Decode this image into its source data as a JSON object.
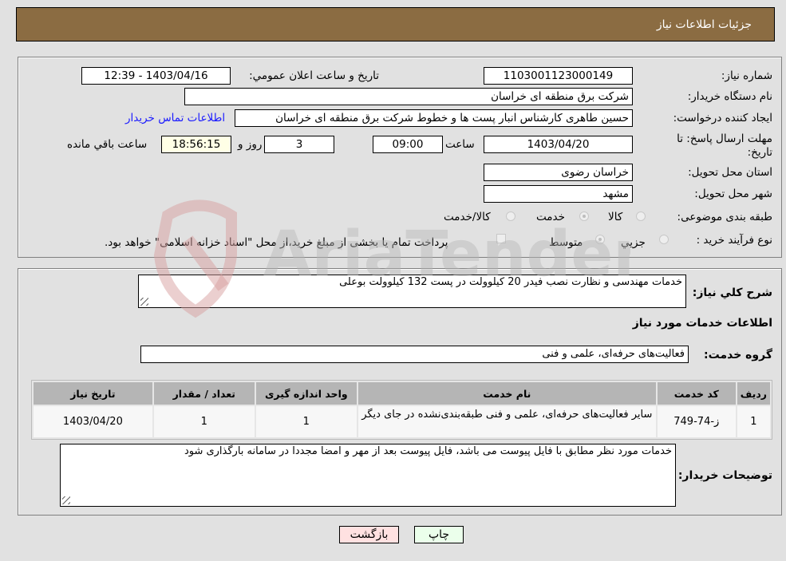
{
  "header": {
    "title": "جزئیات اطلاعات نیاز"
  },
  "form": {
    "need_number": {
      "label": "شماره نیاز:",
      "value": "1103001123000149"
    },
    "announce_datetime": {
      "label": "تاریخ و ساعت اعلان عمومي:",
      "value": "1403/04/16 - 12:39"
    },
    "buyer_org": {
      "label": "نام دستگاه خريدار:",
      "value": "شرکت برق منطقه ای خراسان"
    },
    "requester": {
      "label": "ایجاد کننده درخواست:",
      "value": "حسین طاهری کارشناس انبار پست ها و خطوط شرکت برق منطقه ای خراسان"
    },
    "contact_link": "اطلاعات تماس خريدار",
    "deadline": {
      "label": "مهلت ارسال پاسخ: تا تاریخ:",
      "date": "1403/04/20",
      "time_label": "ساعت",
      "time": "09:00",
      "days": "3",
      "days_label": "روز و",
      "remaining": "18:56:15",
      "remaining_label": "ساعت باقي مانده"
    },
    "province": {
      "label": "استان محل تحویل:",
      "value": "خراسان رضوی"
    },
    "city": {
      "label": "شهر محل تحویل:",
      "value": "مشهد"
    },
    "category": {
      "label": "طبقه بندی موضوعی:",
      "options": [
        "کالا",
        "خدمت",
        "کالا/خدمت"
      ],
      "selected": "خدمت"
    },
    "purchase_type": {
      "label": "نوع فرآیند خرید :",
      "options": [
        "جزيي",
        "متوسط"
      ],
      "selected": "متوسط",
      "treasury_note": "پرداخت تمام يا بخشی از مبلغ خريد،از محل \"اسناد خزانه اسلامی\" خواهد بود.",
      "treasury_checked": false
    }
  },
  "details": {
    "description_label": "شرح كلي نياز:",
    "description": "خدمات مهندسی و نظارت نصب فیدر 20 کیلوولت در پست 132 کیلوولت بوعلی",
    "services_heading": "اطلاعات خدمات مورد نياز",
    "service_group_label": "گروه خدمت:",
    "service_group": "فعالیت‌های حرفه‌ای، علمی و فنی",
    "table": {
      "headers": [
        "رديف",
        "کد خدمت",
        "نام خدمت",
        "واحد اندازه گیری",
        "تعداد / مقدار",
        "تاريخ نياز"
      ],
      "rows": [
        [
          "1",
          "ز-74-749",
          "سایر فعالیت‌های حرفه‌ای، علمی و فنی طبقه‌بندی‌نشده در جای دیگر",
          "1",
          "1",
          "1403/04/20"
        ]
      ]
    },
    "buyer_notes_label": "توضيحات خريدار:",
    "buyer_notes": "خدمات مورد نظر مطابق با فایل پیوست می باشد، فایل پیوست بعد از مهر و امضا مجددا در سامانه بارگذاری شود"
  },
  "buttons": {
    "print": "چاپ",
    "back": "بازگشت"
  },
  "colors": {
    "header": "#8b6c42",
    "print_bg": "#ebffeb",
    "back_bg": "#ffe1e1",
    "link": "#1a1aff"
  }
}
